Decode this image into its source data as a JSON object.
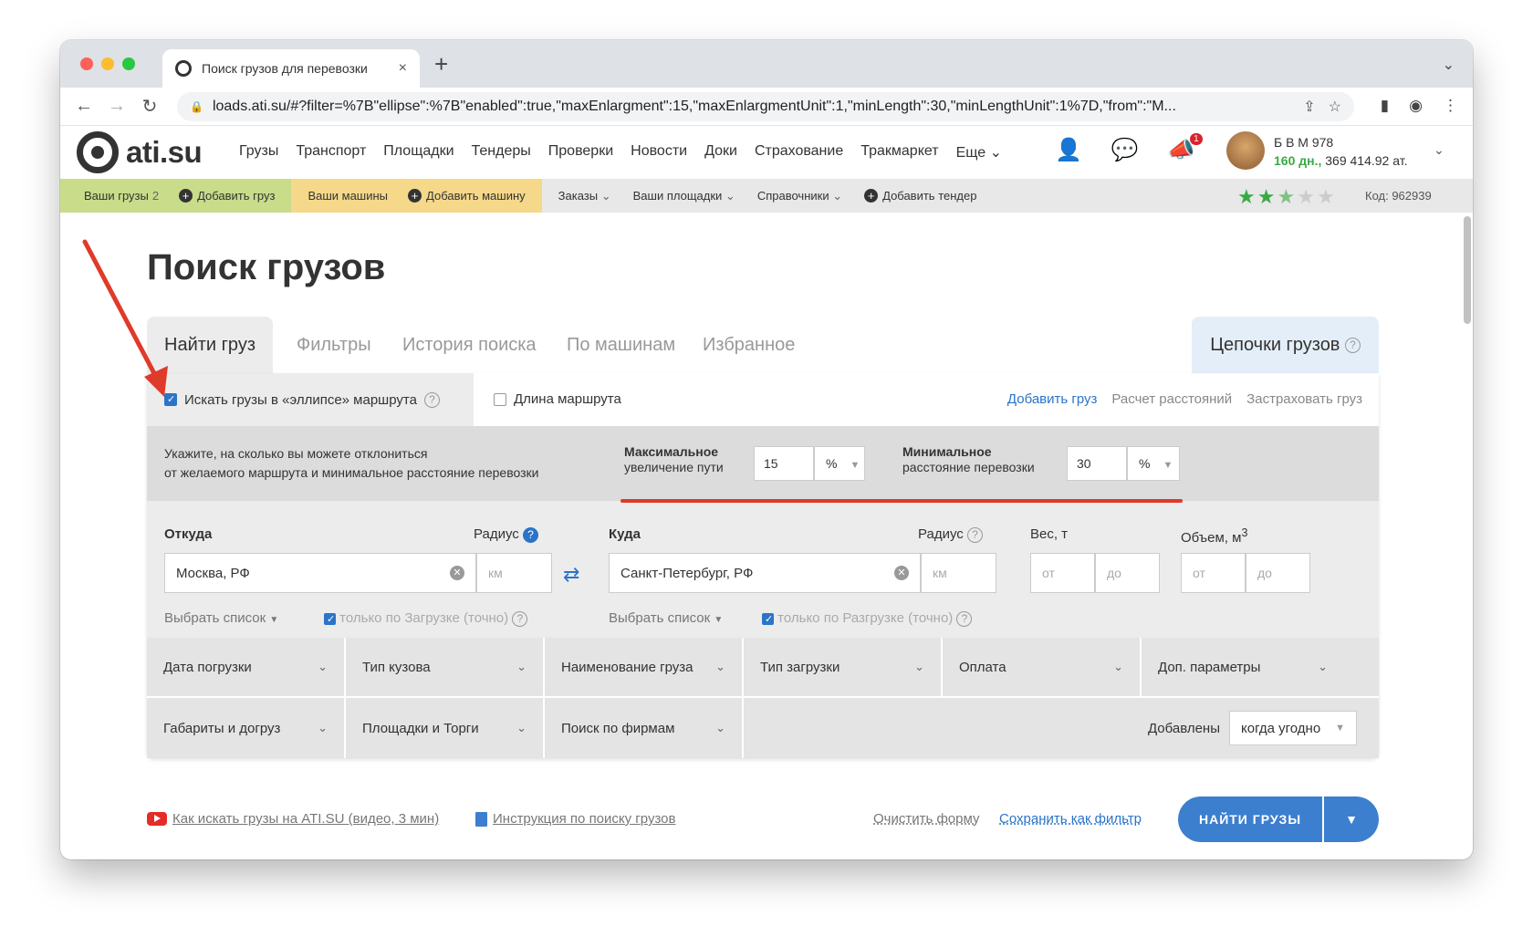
{
  "browser": {
    "tab_title": "Поиск грузов для перевозки",
    "tab_close": "×",
    "new_tab": "+",
    "url": "loads.ati.su/#?filter=%7B\"ellipse\":%7B\"enabled\":true,\"maxEnlargment\":15,\"maxEnlargmentUnit\":1,\"minLength\":30,\"minLengthUnit\":1%7D,\"from\":\"M..."
  },
  "header": {
    "logo": "ati.su",
    "nav": [
      "Грузы",
      "Транспорт",
      "Площадки",
      "Тендеры",
      "Проверки",
      "Новости",
      "Доки",
      "Страхование",
      "Тракмаркет",
      "Еще"
    ],
    "notification_count": "1",
    "user_name": "Б В М 978",
    "user_days": "160 дн.,",
    "user_balance": "369 414.92 ат."
  },
  "subbar": {
    "your_cargo": "Ваши грузы",
    "your_cargo_count": "2",
    "add_cargo": "Добавить груз",
    "your_cars": "Ваши машины",
    "add_car": "Добавить машину",
    "orders": "Заказы",
    "your_sites": "Ваши площадки",
    "references": "Справочники",
    "add_tender": "Добавить тендер",
    "rating_stars": 2.5,
    "code": "Код: 962939"
  },
  "page": {
    "title": "Поиск грузов",
    "tabs": [
      "Найти груз",
      "Фильтры",
      "История поиска",
      "По машинам",
      "Избранное"
    ],
    "chain_tab": "Цепочки грузов",
    "ellipse_label": "Искать грузы в «эллипсе» маршрута",
    "route_length_label": "Длина маршрута",
    "links": [
      "Добавить груз",
      "Расчет расстояний",
      "Застраховать груз"
    ],
    "hint_line1": "Укажите, на сколько вы можете отклониться",
    "hint_line2": "от желаемого маршрута и минимальное расстояние перевозки",
    "max_label_bold": "Максимальное",
    "max_label": "увеличение пути",
    "max_value": "15",
    "max_unit": "%",
    "min_label_bold": "Минимальное",
    "min_label": "расстояние перевозки",
    "min_value": "30",
    "min_unit": "%",
    "from_label": "Откуда",
    "from_value": "Москва, РФ",
    "radius_label": "Радиус",
    "km_placeholder": "км",
    "to_label": "Куда",
    "to_value": "Санкт-Петербург, РФ",
    "weight_label": "Вес, т",
    "volume_label": "Объем, м",
    "volume_sup": "3",
    "from_ph": "от",
    "to_ph": "до",
    "choose_list": "Выбрать список",
    "only_loading": "только по Загрузке (точно)",
    "only_unloading": "только по Разгрузке (точно)",
    "filters_row1": [
      "Дата погрузки",
      "Тип кузова",
      "Наименование груза",
      "Тип загрузки",
      "Оплата",
      "Доп. параметры"
    ],
    "filters_row2": [
      "Габариты и догруз",
      "Площадки и Торги",
      "Поиск по фирмам"
    ],
    "added_label": "Добавлены",
    "added_value": "когда угодно",
    "video_link": "Как искать грузы на ATI.SU (видео, 3 мин)",
    "instruction_link": "Инструкция по поиску грузов",
    "clear_form": "Очистить форму",
    "save_filter": "Сохранить как фильтр",
    "find_button": "НАЙТИ ГРУЗЫ"
  },
  "colors": {
    "accent_blue": "#2b74c8",
    "green_bar": "#c8dc8a",
    "yellow_bar": "#f5d88a",
    "annotation_red": "#e03a2a"
  }
}
